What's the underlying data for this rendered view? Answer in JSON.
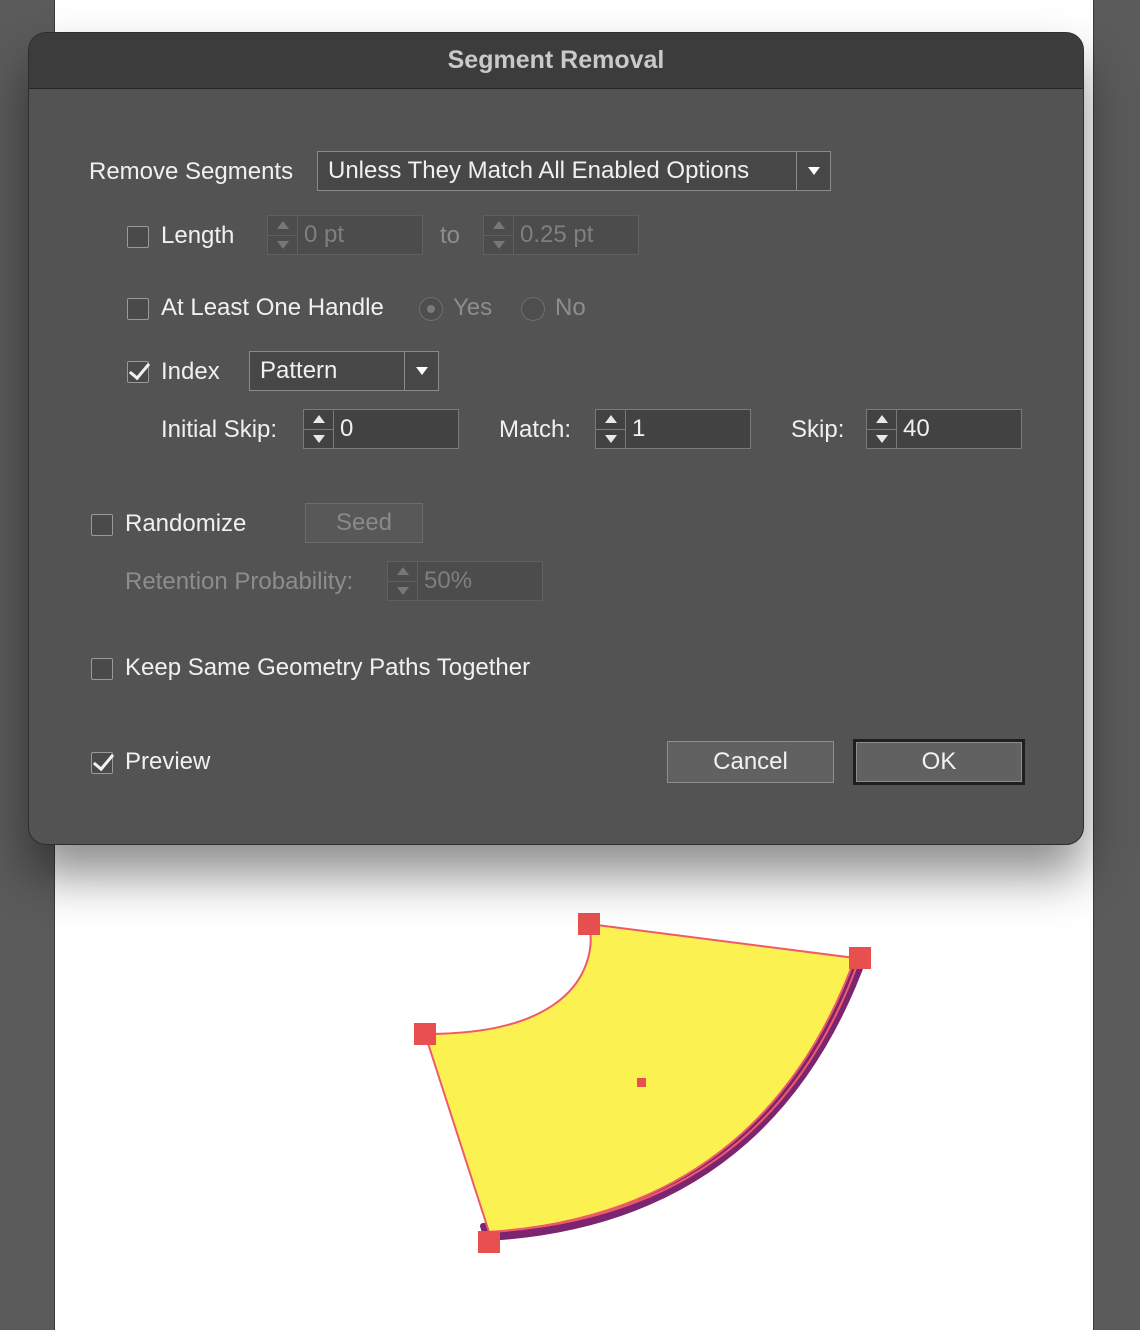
{
  "dialog": {
    "title": "Segment Removal",
    "remove_segments": {
      "label": "Remove Segments",
      "value": "Unless They Match All Enabled Options"
    },
    "length": {
      "label": "Length",
      "checked": false,
      "from": "0 pt",
      "to_label": "to",
      "to": "0.25 pt"
    },
    "handle": {
      "label": "At Least One Handle",
      "checked": false,
      "yes_label": "Yes",
      "no_label": "No"
    },
    "index": {
      "label": "Index",
      "checked": true,
      "mode": "Pattern",
      "initial_skip_label": "Initial Skip:",
      "initial_skip": "0",
      "match_label": "Match:",
      "match": "1",
      "skip_label": "Skip:",
      "skip": "40"
    },
    "randomize": {
      "label": "Randomize",
      "checked": false,
      "seed_label": "Seed",
      "retention_label": "Retention Probability:",
      "retention": "50%"
    },
    "keep_geometry": {
      "label": "Keep Same Geometry Paths Together",
      "checked": false
    },
    "preview": {
      "label": "Preview",
      "checked": true
    },
    "cancel_label": "Cancel",
    "ok_label": "OK"
  },
  "colors": {
    "fill": "#fbf150",
    "stroke": "#7d2470",
    "anchor": "#e8504f",
    "path_line": "#ee5a6a"
  }
}
